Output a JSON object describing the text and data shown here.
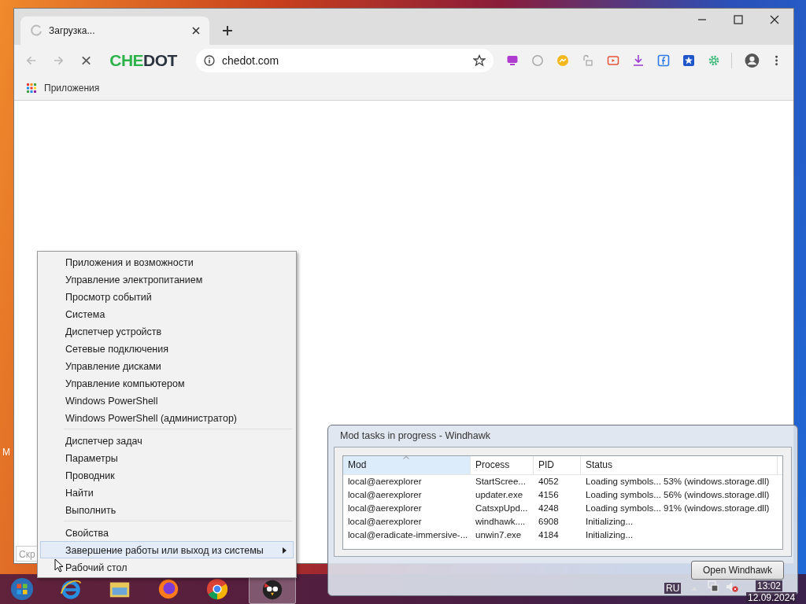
{
  "desktop": {
    "icon_label": "M"
  },
  "browser": {
    "tab": {
      "title": "Загрузка...",
      "loading": true
    },
    "logo": {
      "first": "CHE",
      "second": "DOT"
    },
    "address": "chedot.com",
    "bookmarks": [
      "Приложения"
    ],
    "bottom_field": "Скр"
  },
  "context_menu": {
    "groups": [
      [
        {
          "label": "Приложения и возможности",
          "selected": false,
          "submenu": false
        },
        {
          "label": "Управление электропитанием",
          "selected": false,
          "submenu": false
        },
        {
          "label": "Просмотр событий",
          "selected": false,
          "submenu": false
        },
        {
          "label": "Система",
          "selected": false,
          "submenu": false
        },
        {
          "label": "Диспетчер устройств",
          "selected": false,
          "submenu": false
        },
        {
          "label": "Сетевые подключения",
          "selected": false,
          "submenu": false
        },
        {
          "label": "Управление дисками",
          "selected": false,
          "submenu": false
        },
        {
          "label": "Управление компьютером",
          "selected": false,
          "submenu": false
        },
        {
          "label": "Windows PowerShell",
          "selected": false,
          "submenu": false
        },
        {
          "label": "Windows PowerShell (администратор)",
          "selected": false,
          "submenu": false
        }
      ],
      [
        {
          "label": "Диспетчер задач",
          "selected": false,
          "submenu": false
        },
        {
          "label": "Параметры",
          "selected": false,
          "submenu": false
        },
        {
          "label": "Проводник",
          "selected": false,
          "submenu": false
        },
        {
          "label": "Найти",
          "selected": false,
          "submenu": false
        },
        {
          "label": "Выполнить",
          "selected": false,
          "submenu": false
        }
      ],
      [
        {
          "label": "Свойства",
          "selected": false,
          "submenu": false
        },
        {
          "label": "Завершение работы или выход из системы",
          "selected": true,
          "submenu": true
        },
        {
          "label": "Рабочий стол",
          "selected": false,
          "submenu": false
        }
      ]
    ]
  },
  "dialog": {
    "title": "Mod tasks in progress - Windhawk",
    "columns": [
      {
        "label": "Mod",
        "sorted": true
      },
      {
        "label": "Process",
        "sorted": false
      },
      {
        "label": "PID",
        "sorted": false
      },
      {
        "label": "Status",
        "sorted": false
      }
    ],
    "rows": [
      [
        "local@aerexplorer",
        "StartScree...",
        "4052",
        "Loading symbols... 53% (windows.storage.dll)"
      ],
      [
        "local@aerexplorer",
        "updater.exe",
        "4156",
        "Loading symbols... 56% (windows.storage.dll)"
      ],
      [
        "local@aerexplorer",
        "CatsxpUpd...",
        "4248",
        "Loading symbols... 91% (windows.storage.dll)"
      ],
      [
        "local@aerexplorer",
        "windhawk....",
        "6908",
        "Initializing..."
      ],
      [
        "local@eradicate-immersive-...",
        "unwin7.exe",
        "4184",
        "Initializing..."
      ]
    ],
    "button": "Open Windhawk"
  },
  "taskbar": {
    "buttons": [
      {
        "kind": "start",
        "selected": false
      },
      {
        "kind": "ie",
        "selected": false
      },
      {
        "kind": "folder",
        "selected": false
      },
      {
        "kind": "firefox",
        "selected": false
      },
      {
        "kind": "chrome",
        "selected": false
      },
      {
        "kind": "bird",
        "selected": true
      }
    ],
    "language": "RU",
    "time": "13:02",
    "date": "12.09.2024"
  }
}
